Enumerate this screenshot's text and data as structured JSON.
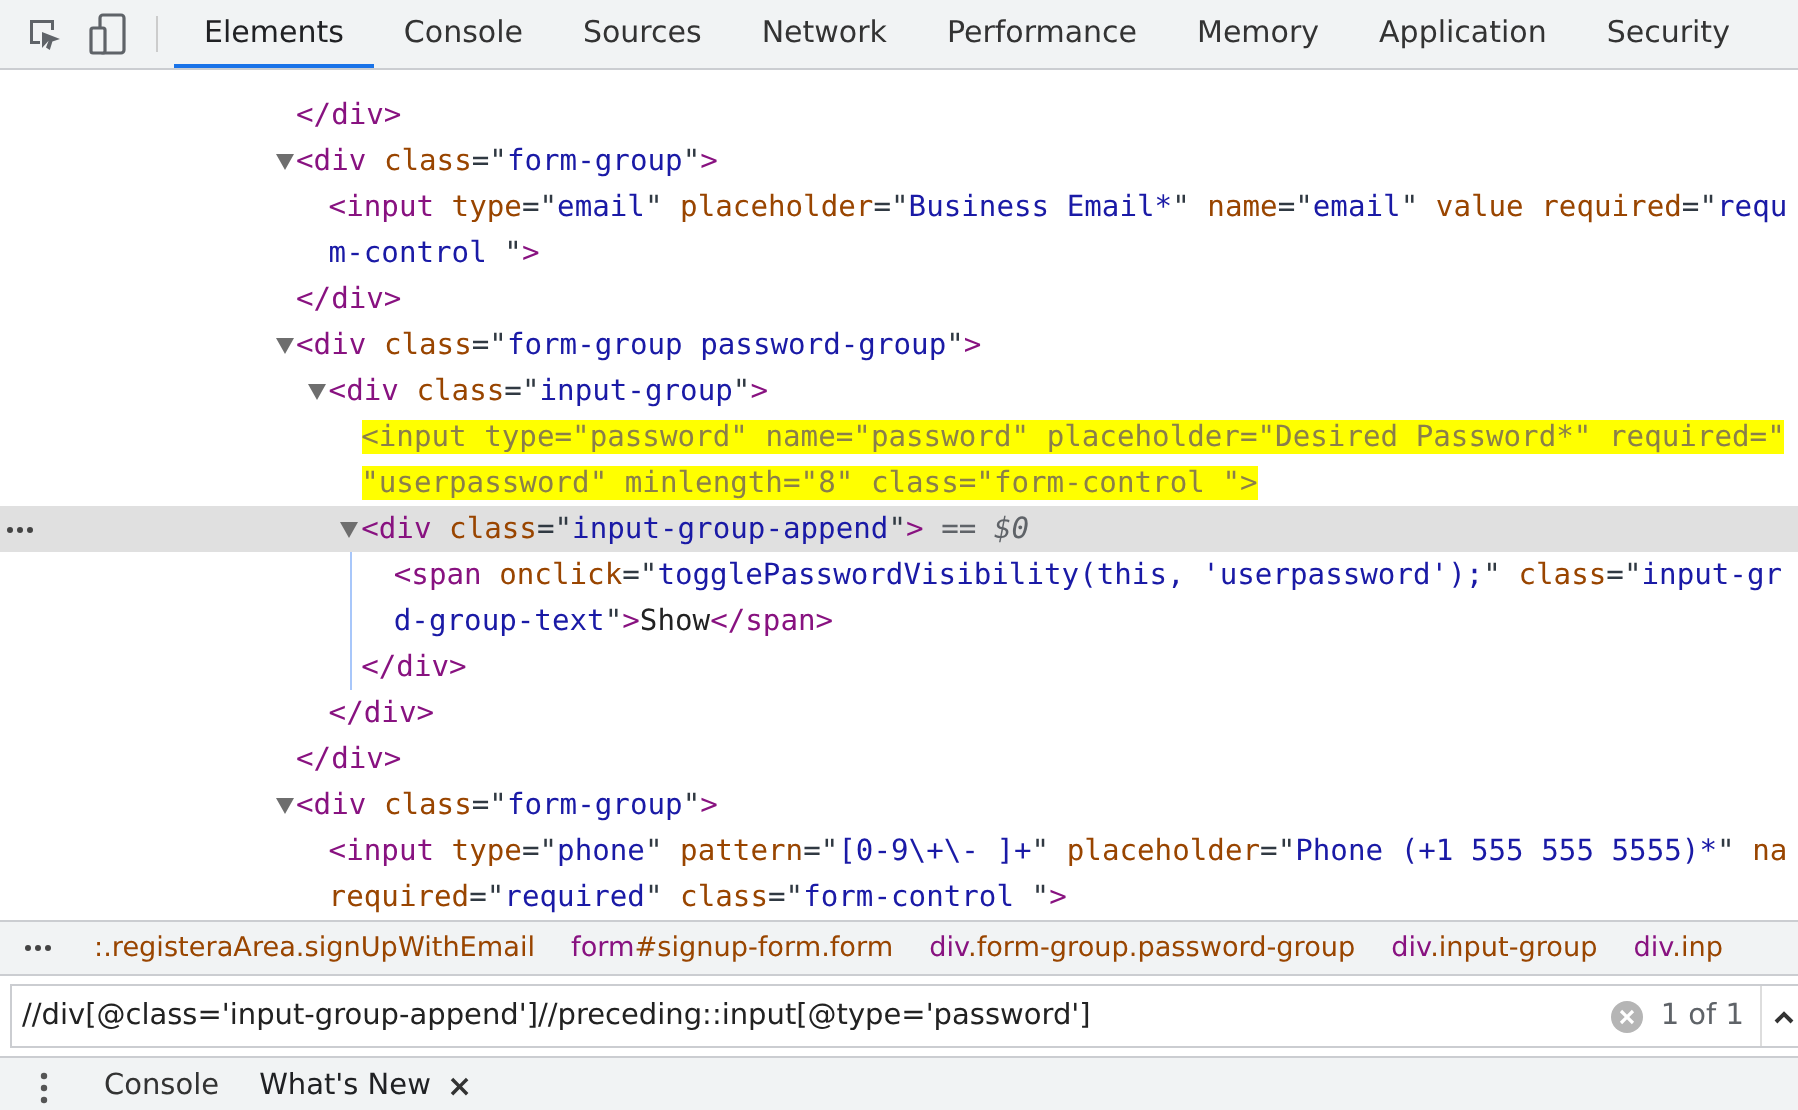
{
  "tabs": [
    {
      "label": "Elements",
      "selected": true
    },
    {
      "label": "Console",
      "selected": false
    },
    {
      "label": "Sources",
      "selected": false
    },
    {
      "label": "Network",
      "selected": false
    },
    {
      "label": "Performance",
      "selected": false
    },
    {
      "label": "Memory",
      "selected": false
    },
    {
      "label": "Application",
      "selected": false
    },
    {
      "label": "Security",
      "selected": false
    }
  ],
  "dom": [
    {
      "selected": false,
      "highlighted": false,
      "lines": [
        [
          {
            "tag": "</div>"
          }
        ]
      ]
    },
    {
      "expanded": true,
      "selected": false,
      "highlighted": false,
      "lines": [
        [
          {
            "tag": "<div"
          },
          {
            "attr": " class"
          },
          {
            "eq": "=\""
          },
          {
            "val": "form-group"
          },
          {
            "eq": "\""
          },
          {
            "tag": ">"
          }
        ]
      ],
      "children": [
        {
          "selected": false,
          "highlighted": false,
          "lines": [
            [
              {
                "tag": "<input"
              },
              {
                "attr": " type"
              },
              {
                "eq": "=\""
              },
              {
                "val": "email"
              },
              {
                "eq": "\""
              },
              {
                "attr": " placeholder"
              },
              {
                "eq": "=\""
              },
              {
                "val": "Business Email*"
              },
              {
                "eq": "\""
              },
              {
                "attr": " name"
              },
              {
                "eq": "=\""
              },
              {
                "val": "email"
              },
              {
                "eq": "\""
              },
              {
                "attr": " value required"
              },
              {
                "eq": "=\""
              },
              {
                "val": "requ"
              }
            ],
            [
              {
                "val": "m-control "
              },
              {
                "eq": "\""
              },
              {
                "tag": ">"
              }
            ]
          ]
        }
      ],
      "close": [
        {
          "tag": "</div>"
        }
      ]
    },
    {
      "expanded": true,
      "selected": false,
      "highlighted": false,
      "lines": [
        [
          {
            "tag": "<div"
          },
          {
            "attr": " class"
          },
          {
            "eq": "=\""
          },
          {
            "val": "form-group password-group"
          },
          {
            "eq": "\""
          },
          {
            "tag": ">"
          }
        ]
      ],
      "children": [
        {
          "expanded": true,
          "selected": false,
          "highlighted": false,
          "lines": [
            [
              {
                "tag": "<div"
              },
              {
                "attr": " class"
              },
              {
                "eq": "=\""
              },
              {
                "val": "input-group"
              },
              {
                "eq": "\""
              },
              {
                "tag": ">"
              }
            ]
          ],
          "children": [
            {
              "selected": false,
              "highlighted": true,
              "lines": [
                [
                  {
                    "tag": "<input"
                  },
                  {
                    "attr": " type"
                  },
                  {
                    "eq": "=\""
                  },
                  {
                    "val": "password"
                  },
                  {
                    "eq": "\""
                  },
                  {
                    "attr": " name"
                  },
                  {
                    "eq": "=\""
                  },
                  {
                    "val": "password"
                  },
                  {
                    "eq": "\""
                  },
                  {
                    "attr": " placeholder"
                  },
                  {
                    "eq": "=\""
                  },
                  {
                    "val": "Desired Password*"
                  },
                  {
                    "eq": "\""
                  },
                  {
                    "attr": " required"
                  },
                  {
                    "eq": "=\""
                  }
                ],
                [
                  {
                    "val": "\"userpassword\""
                  },
                  {
                    "attr": " minlength"
                  },
                  {
                    "eq": "=\""
                  },
                  {
                    "val": "8"
                  },
                  {
                    "eq": "\""
                  },
                  {
                    "attr": " class"
                  },
                  {
                    "eq": "=\""
                  },
                  {
                    "val": "form-control "
                  },
                  {
                    "eq": "\""
                  },
                  {
                    "tag": ">"
                  }
                ]
              ]
            },
            {
              "expanded": true,
              "selected": true,
              "highlighted": false,
              "lines": [
                [
                  {
                    "tag": "<div"
                  },
                  {
                    "attr": " class"
                  },
                  {
                    "eq": "=\""
                  },
                  {
                    "val": "input-group-append"
                  },
                  {
                    "eq": "\""
                  },
                  {
                    "tag": ">"
                  },
                  {
                    "note": " == $0"
                  }
                ]
              ],
              "children": [
                {
                  "selected": false,
                  "highlighted": false,
                  "lines": [
                    [
                      {
                        "tag": "<span"
                      },
                      {
                        "attr": " onclick"
                      },
                      {
                        "eq": "=\""
                      },
                      {
                        "val": "togglePasswordVisibility(this, 'userpassword');"
                      },
                      {
                        "eq": "\""
                      },
                      {
                        "attr": " class"
                      },
                      {
                        "eq": "=\""
                      },
                      {
                        "val": "input-gr"
                      }
                    ],
                    [
                      {
                        "val": "d-group-text"
                      },
                      {
                        "eq": "\""
                      },
                      {
                        "tag": ">"
                      },
                      {
                        "text": "Show"
                      },
                      {
                        "tag": "</span>"
                      }
                    ]
                  ]
                }
              ],
              "close": [
                {
                  "tag": "</div>"
                }
              ]
            }
          ],
          "close": [
            {
              "tag": "</div>"
            }
          ]
        }
      ],
      "close": [
        {
          "tag": "</div>"
        }
      ]
    },
    {
      "expanded": true,
      "selected": false,
      "highlighted": false,
      "lines": [
        [
          {
            "tag": "<div"
          },
          {
            "attr": " class"
          },
          {
            "eq": "=\""
          },
          {
            "val": "form-group"
          },
          {
            "eq": "\""
          },
          {
            "tag": ">"
          }
        ]
      ],
      "children": [
        {
          "selected": false,
          "highlighted": false,
          "lines": [
            [
              {
                "tag": "<input"
              },
              {
                "attr": " type"
              },
              {
                "eq": "=\""
              },
              {
                "val": "phone"
              },
              {
                "eq": "\""
              },
              {
                "attr": " pattern"
              },
              {
                "eq": "=\""
              },
              {
                "val": "[0-9\\+\\- ]+"
              },
              {
                "eq": "\""
              },
              {
                "attr": " placeholder"
              },
              {
                "eq": "=\""
              },
              {
                "val": "Phone (+1 555 555 5555)*"
              },
              {
                "eq": "\""
              },
              {
                "attr": " na"
              }
            ],
            [
              {
                "attr": "required"
              },
              {
                "eq": "=\""
              },
              {
                "val": "required"
              },
              {
                "eq": "\""
              },
              {
                "attr": " class"
              },
              {
                "eq": "=\""
              },
              {
                "val": "form-control "
              },
              {
                "eq": "\""
              },
              {
                "tag": ">"
              }
            ]
          ]
        }
      ]
    }
  ],
  "breadcrumbs": [
    {
      "rest": ":.registeraArea.signUpWithEmail"
    },
    {
      "tag": "form",
      "rest": "#signup-form.form"
    },
    {
      "tag": "div",
      "rest": ".form-group.password-group"
    },
    {
      "tag": "div",
      "rest": ".input-group"
    },
    {
      "tag": "div",
      "rest": ".inp"
    }
  ],
  "search": {
    "value": "//div[@class='input-group-append']//preceding::input[@type='password']",
    "count": "1 of 1"
  },
  "drawer_tabs": [
    {
      "label": "Console",
      "selected": false,
      "closable": false
    },
    {
      "label": "What's New",
      "selected": true,
      "closable": true
    }
  ],
  "close_glyph": "×"
}
